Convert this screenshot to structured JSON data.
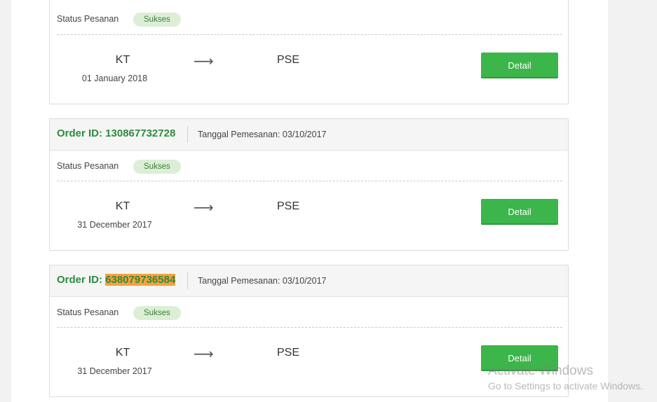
{
  "orders": [
    {
      "order_id_label": "",
      "order_id": "",
      "date_label": "",
      "status_label": "Status Pesanan",
      "status": "Sukses",
      "from": "KT",
      "to": "PSE",
      "departure_date": "01 January 2018",
      "detail_label": "Detail"
    },
    {
      "order_id_label": "Order ID: ",
      "order_id": "130867732728",
      "date_label": "Tanggal Pemesanan: 03/10/2017",
      "status_label": "Status Pesanan",
      "status": "Sukses",
      "from": "KT",
      "to": "PSE",
      "departure_date": "31 December 2017",
      "detail_label": "Detail"
    },
    {
      "order_id_label": "Order ID: ",
      "order_id": "638079736584",
      "date_label": "Tanggal Pemesanan: 03/10/2017",
      "status_label": "Status Pesanan",
      "status": "Sukses",
      "from": "KT",
      "to": "PSE",
      "departure_date": "31 December 2017",
      "detail_label": "Detail"
    }
  ],
  "arrow_icon": "arrow-right-icon",
  "watermark": {
    "line1": "Activate Windows",
    "line2": "Go to Settings to activate Windows."
  },
  "colors": {
    "accent_green": "#3cb54a",
    "order_id_green": "#2e8b3e",
    "highlight": "#f7a13b",
    "badge_bg": "#dcefd6"
  }
}
